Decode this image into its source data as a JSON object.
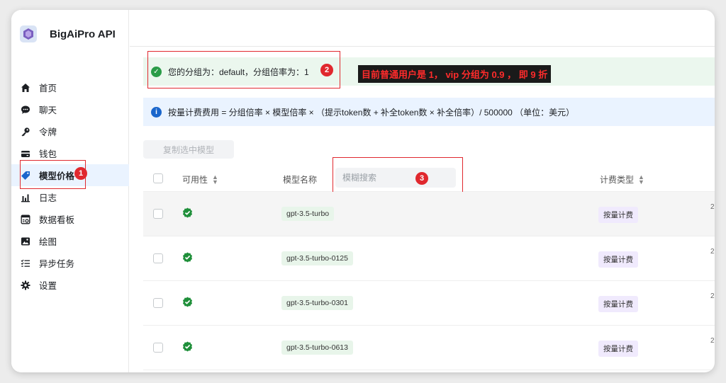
{
  "app": {
    "name": "BigAiPro API"
  },
  "sidebar": {
    "items": [
      {
        "label": "首页",
        "icon": "home-icon"
      },
      {
        "label": "聊天",
        "icon": "chat-icon"
      },
      {
        "label": "令牌",
        "icon": "key-icon"
      },
      {
        "label": "钱包",
        "icon": "wallet-icon"
      },
      {
        "label": "模型价格",
        "icon": "price-tag-icon",
        "active": true
      },
      {
        "label": "日志",
        "icon": "bar-chart-icon"
      },
      {
        "label": "数据看板",
        "icon": "dashboard-icon"
      },
      {
        "label": "绘图",
        "icon": "image-icon"
      },
      {
        "label": "异步任务",
        "icon": "task-list-icon"
      },
      {
        "label": "设置",
        "icon": "gear-icon"
      }
    ]
  },
  "banners": {
    "group": "您的分组为：default，分组倍率为：1",
    "pricing": "按量计费费用 = 分组倍率 × 模型倍率 × （提示token数 + 补全token数 × 补全倍率）/ 500000 （单位：美元）"
  },
  "annotations": {
    "note": "目前普通用户是 1， vip 分组为 0.9 ， 即 9 折",
    "markers": [
      "1",
      "2",
      "3"
    ]
  },
  "toolbar": {
    "copy_label": "复制选中模型"
  },
  "table": {
    "columns": {
      "availability": "可用性",
      "model_name": "模型名称",
      "billing_type": "计费类型"
    },
    "search_placeholder": "模糊搜索",
    "rows": [
      {
        "model": "gpt-3.5-turbo",
        "billing": "按量计费",
        "edge": "2"
      },
      {
        "model": "gpt-3.5-turbo-0125",
        "billing": "按量计费",
        "edge": "2"
      },
      {
        "model": "gpt-3.5-turbo-0301",
        "billing": "按量计费",
        "edge": "2"
      },
      {
        "model": "gpt-3.5-turbo-0613",
        "billing": "按量计费",
        "edge": "2"
      }
    ]
  },
  "colors": {
    "accent": "#1a66cc",
    "success": "#1f8f3a",
    "annotation": "#e0282e"
  }
}
